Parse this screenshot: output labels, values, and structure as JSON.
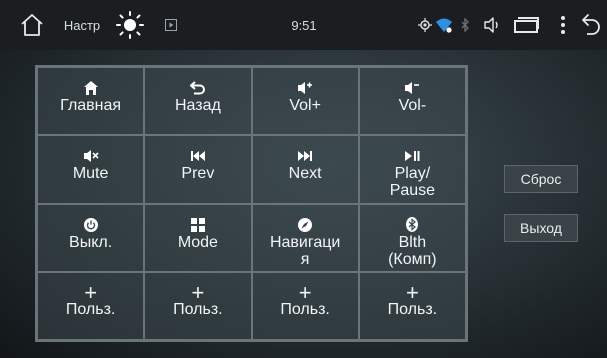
{
  "status_bar": {
    "app_title": "Настр",
    "time": "9:51"
  },
  "grid": {
    "cells": [
      {
        "label": "Главная",
        "icon": "home-icon"
      },
      {
        "label": "Назад",
        "icon": "back-arrow-icon"
      },
      {
        "label": "Vol+",
        "icon": "volume-up-icon"
      },
      {
        "label": "Vol-",
        "icon": "volume-down-icon"
      },
      {
        "label": "Mute",
        "icon": "mute-icon"
      },
      {
        "label": "Prev",
        "icon": "previous-track-icon"
      },
      {
        "label": "Next",
        "icon": "next-track-icon"
      },
      {
        "label": "Play/\nPause",
        "icon": "play-pause-icon"
      },
      {
        "label": "Выкл.",
        "icon": "power-icon"
      },
      {
        "label": "Mode",
        "icon": "mode-grid-icon"
      },
      {
        "label": "Навигаци\nя",
        "icon": "navigation-icon"
      },
      {
        "label": "Blth\n(Комп)",
        "icon": "bluetooth-icon"
      },
      {
        "label": "Польз.",
        "icon": "plus-icon"
      },
      {
        "label": "Польз.",
        "icon": "plus-icon"
      },
      {
        "label": "Польз.",
        "icon": "plus-icon"
      },
      {
        "label": "Польз.",
        "icon": "plus-icon"
      }
    ]
  },
  "side_buttons": {
    "reset": "Сброс",
    "exit": "Выход"
  },
  "colors": {
    "accent_wifi": "#2f8fe0",
    "statusbar_bg": "#1a1e20",
    "grid_line": "#6b7479"
  }
}
